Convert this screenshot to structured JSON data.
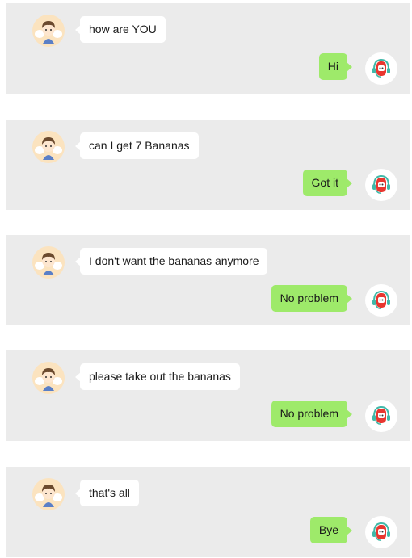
{
  "conversations": [
    {
      "user_message": "how are YOU",
      "bot_reply": "Hi"
    },
    {
      "user_message": "can I get 7 Bananas",
      "bot_reply": "Got it"
    },
    {
      "user_message": "I don't want the bananas anymore",
      "bot_reply": "No problem"
    },
    {
      "user_message": "please take out the bananas",
      "bot_reply": "No problem"
    },
    {
      "user_message": "that's all",
      "bot_reply": "Bye"
    }
  ],
  "icons": {
    "user_avatar": "angel-boy-avatar-icon",
    "bot_avatar": "red-robot-avatar-icon"
  },
  "colors": {
    "card_background": "#ebebeb",
    "user_bubble": "#ffffff",
    "bot_bubble": "#9eea6a",
    "user_avatar_background": "#fbe3bf"
  }
}
